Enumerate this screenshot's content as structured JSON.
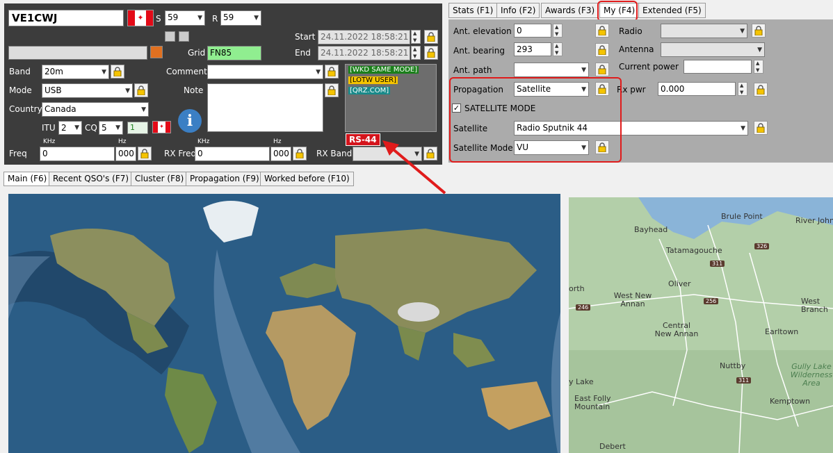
{
  "callsign": "VE1CWJ",
  "rst": {
    "s_label": "S",
    "s_value": "59",
    "r_label": "R",
    "r_value": "59"
  },
  "start": {
    "label": "Start",
    "value": "24.11.2022 18:58:21"
  },
  "end": {
    "label": "End",
    "value": "24.11.2022 18:58:21"
  },
  "grid": {
    "label": "Grid",
    "value": "FN85"
  },
  "band": {
    "label": "Band",
    "value": "20m"
  },
  "mode": {
    "label": "Mode",
    "value": "USB"
  },
  "country": {
    "label": "Country",
    "value": "Canada"
  },
  "itu": {
    "label": "ITU",
    "value": "2"
  },
  "cq": {
    "label": "CQ",
    "value": "5",
    "extra": "1"
  },
  "comment": {
    "label": "Comment",
    "value": ""
  },
  "note": {
    "label": "Note",
    "value": ""
  },
  "tags": {
    "wkd": "[WKD SAME MODE]",
    "lotw": "[LOTW USER]",
    "qrz": "[QRZ.COM]"
  },
  "sat_badge": "RS-44",
  "freq": {
    "label": "Freq",
    "khz_label": "KHz",
    "hz_label": "Hz",
    "khz": "0",
    "hz": "000"
  },
  "rx_freq": {
    "label": "RX Freq",
    "khz_label": "KHz",
    "hz_label": "Hz",
    "khz": "0",
    "hz": "000"
  },
  "rx_band": {
    "label": "RX Band",
    "value": ""
  },
  "top_tabs": [
    "Stats (F1)",
    "Info (F2)",
    "Awards (F3)",
    "My (F4)",
    "Extended (F5)"
  ],
  "bottom_tabs": [
    "Main (F6)",
    "Recent QSO's (F7)",
    "Cluster (F8)",
    "Propagation (F9)",
    "Worked before (F10)"
  ],
  "my_panel": {
    "ant_elevation": {
      "label": "Ant. elevation",
      "value": "0"
    },
    "ant_bearing": {
      "label": "Ant. bearing",
      "value": "293"
    },
    "ant_path": {
      "label": "Ant. path",
      "value": ""
    },
    "radio": {
      "label": "Radio",
      "value": ""
    },
    "antenna": {
      "label": "Antenna",
      "value": ""
    },
    "current_power": {
      "label": "Current power",
      "value": ""
    },
    "propagation": {
      "label": "Propagation",
      "value": "Satellite"
    },
    "rx_pwr": {
      "label": "Rx pwr",
      "value": "0.000"
    },
    "sat_mode_check": {
      "label": "SATELLITE MODE",
      "checked": true
    },
    "satellite": {
      "label": "Satellite",
      "value": "Radio Sputnik 44"
    },
    "satellite_mode": {
      "label": "Satellite Mode",
      "value": "VU"
    }
  },
  "map_labels": {
    "places": [
      "Bayhead",
      "Brule Point",
      "River John",
      "Tatamagouche",
      "Oliver",
      "West New Annan",
      "Central New Annan",
      "West Branch River John",
      "Earltown",
      "Nuttby",
      "Gully Lake Wilderness Area",
      "East Folly Mountain",
      "Kemptown",
      "Debert"
    ],
    "places_partial": [
      "orth",
      "y Lake"
    ],
    "routes": [
      "326",
      "311",
      "256",
      "246",
      "311"
    ]
  },
  "colors": {
    "accent_red": "#e01b1b",
    "panel_dark": "#3c3c3c",
    "grid_green": "#90ee90",
    "lotw_yellow": "#f5c400",
    "wkd_green": "#1a7f1a",
    "qrz_teal": "#198a8a"
  }
}
